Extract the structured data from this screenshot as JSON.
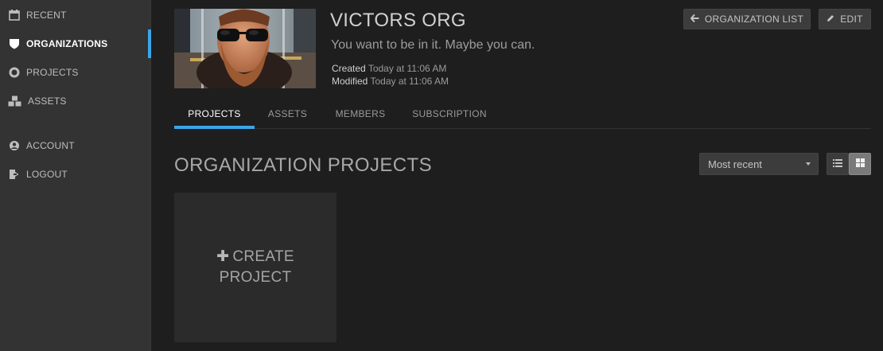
{
  "sidebar": {
    "items": [
      {
        "label": "RECENT",
        "icon": "calendar-icon"
      },
      {
        "label": "ORGANIZATIONS",
        "icon": "shield-icon",
        "active": true
      },
      {
        "label": "PROJECTS",
        "icon": "circle-icon"
      },
      {
        "label": "ASSETS",
        "icon": "cubes-icon"
      },
      {
        "label": "ACCOUNT",
        "icon": "user-account-icon"
      },
      {
        "label": "LOGOUT",
        "icon": "logout-icon"
      }
    ]
  },
  "org": {
    "title": "VICTORS ORG",
    "tagline": "You want to be in it. Maybe you can.",
    "created_label": "Created",
    "created_value": "Today at 11:06 AM",
    "modified_label": "Modified",
    "modified_value": "Today at 11:06 AM"
  },
  "header_buttons": {
    "org_list": "ORGANIZATION LIST",
    "edit": "EDIT"
  },
  "tabs": [
    {
      "label": "PROJECTS",
      "active": true
    },
    {
      "label": "ASSETS"
    },
    {
      "label": "MEMBERS"
    },
    {
      "label": "SUBSCRIPTION"
    }
  ],
  "section": {
    "title": "ORGANIZATION PROJECTS",
    "sort_value": "Most recent",
    "view_mode": "grid"
  },
  "create_card": {
    "line1": "CREATE",
    "line2": "PROJECT"
  },
  "colors": {
    "accent": "#3aa6e8",
    "sidebar_bg": "#333333",
    "page_bg": "#1e1e1e"
  }
}
